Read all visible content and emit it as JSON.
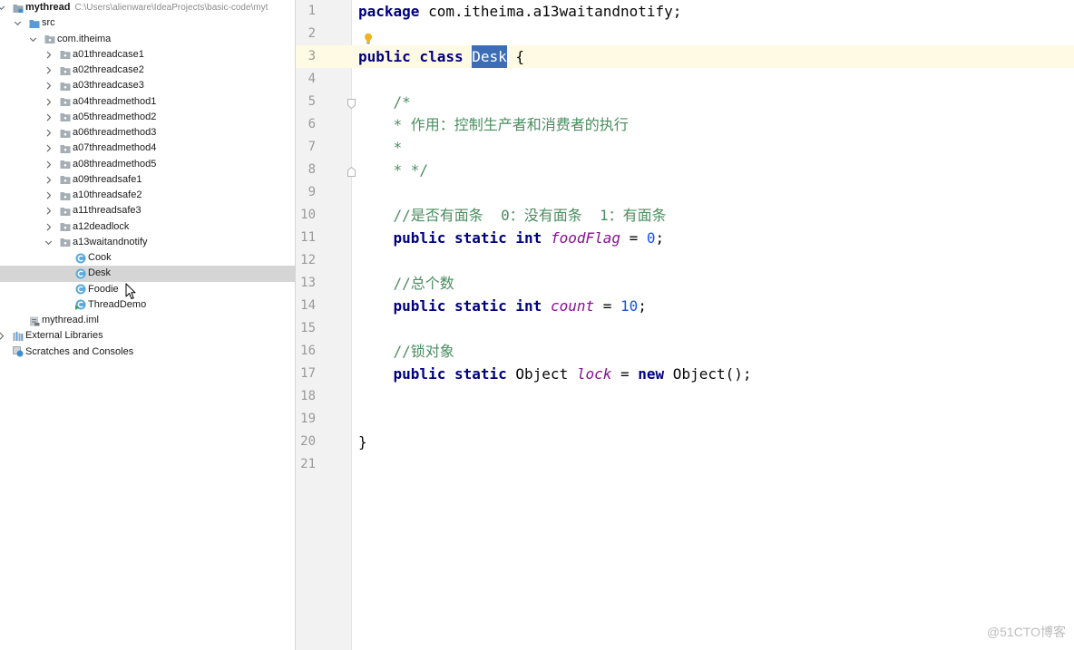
{
  "tree": {
    "root": {
      "label": "mythread",
      "path": "C:\\Users\\alienware\\IdeaProjects\\basic-code\\myt"
    },
    "src": "src",
    "package": "com.itheima",
    "folders": [
      "a01threadcase1",
      "a02threadcase2",
      "a03threadcase3",
      "a04threadmethod1",
      "a05threadmethod2",
      "a06threadmethod3",
      "a07threadmethod4",
      "a08threadmethod5",
      "a09threadsafe1",
      "a10threadsafe2",
      "a11threadsafe3",
      "a12deadlock"
    ],
    "open_folder": "a13waitandnotify",
    "classes": [
      {
        "label": "Cook",
        "icon": "class-icon"
      },
      {
        "label": "Desk",
        "icon": "class-icon"
      },
      {
        "label": "Foodie",
        "icon": "class-icon"
      },
      {
        "label": "ThreadDemo",
        "icon": "runnable-class-icon"
      }
    ],
    "selected_class": "Desk",
    "module_file": "mythread.iml",
    "external_libraries": "External Libraries",
    "scratches": "Scratches and Consoles"
  },
  "icons": {
    "root": "module-folder-icon",
    "src": "source-folder-icon",
    "package": "package-icon",
    "folder": "package-icon",
    "module_file": "module-file-icon",
    "external_libraries": "libraries-icon",
    "scratches": "scratches-icon",
    "intention": "lightbulb-icon",
    "fold": "fold-marker-icon",
    "pointer": "mouse-pointer-icon"
  },
  "editor": {
    "current_line": 3,
    "line_numbers": [
      "1",
      "2",
      "3",
      "4",
      "5",
      "6",
      "7",
      "8",
      "9",
      "10",
      "11",
      "12",
      "13",
      "14",
      "15",
      "16",
      "17",
      "18",
      "19",
      "20",
      "21"
    ],
    "lines": [
      [
        {
          "t": "keyword",
          "v": "package"
        },
        {
          "t": "plain",
          "v": " com.itheima.a13waitandnotify;"
        }
      ],
      [],
      [
        {
          "t": "keyword",
          "v": "public class"
        },
        {
          "t": "plain",
          "v": " "
        },
        {
          "t": "selection",
          "v": "Desk"
        },
        {
          "t": "plain",
          "v": " {"
        }
      ],
      [],
      [
        {
          "t": "comment",
          "v": "    /*"
        }
      ],
      [
        {
          "t": "comment",
          "v": "    * 作用：控制生产者和消费者的执行"
        }
      ],
      [
        {
          "t": "comment",
          "v": "    *"
        }
      ],
      [
        {
          "t": "comment",
          "v": "    * */"
        }
      ],
      [],
      [
        {
          "t": "comment",
          "v": "    //是否有面条  0：没有面条  1：有面条"
        }
      ],
      [
        {
          "t": "plain",
          "v": "    "
        },
        {
          "t": "keyword",
          "v": "public static int"
        },
        {
          "t": "plain",
          "v": " "
        },
        {
          "t": "field",
          "v": "foodFlag"
        },
        {
          "t": "plain",
          "v": " = "
        },
        {
          "t": "number",
          "v": "0"
        },
        {
          "t": "plain",
          "v": ";"
        }
      ],
      [],
      [
        {
          "t": "comment",
          "v": "    //总个数"
        }
      ],
      [
        {
          "t": "plain",
          "v": "    "
        },
        {
          "t": "keyword",
          "v": "public static int"
        },
        {
          "t": "plain",
          "v": " "
        },
        {
          "t": "field",
          "v": "count"
        },
        {
          "t": "plain",
          "v": " = "
        },
        {
          "t": "number",
          "v": "10"
        },
        {
          "t": "plain",
          "v": ";"
        }
      ],
      [],
      [
        {
          "t": "comment",
          "v": "    //锁对象"
        }
      ],
      [
        {
          "t": "plain",
          "v": "    "
        },
        {
          "t": "keyword",
          "v": "public static"
        },
        {
          "t": "plain",
          "v": " Object "
        },
        {
          "t": "field",
          "v": "lock"
        },
        {
          "t": "plain",
          "v": " = "
        },
        {
          "t": "keyword",
          "v": "new"
        },
        {
          "t": "plain",
          "v": " Object();"
        }
      ],
      [],
      [],
      [
        {
          "t": "plain",
          "v": "}"
        }
      ],
      []
    ]
  },
  "colors": {
    "keyword": "#000080",
    "field": "#871094",
    "number": "#1750eb",
    "comment": "#4a8d5f",
    "plain": "#080808",
    "selection_bg": "#3d6db5",
    "selection_text": "#ffffff",
    "current_line": "#fffae3",
    "tree_selection": "#d5d5d5"
  },
  "watermark": "@51CTO博客"
}
